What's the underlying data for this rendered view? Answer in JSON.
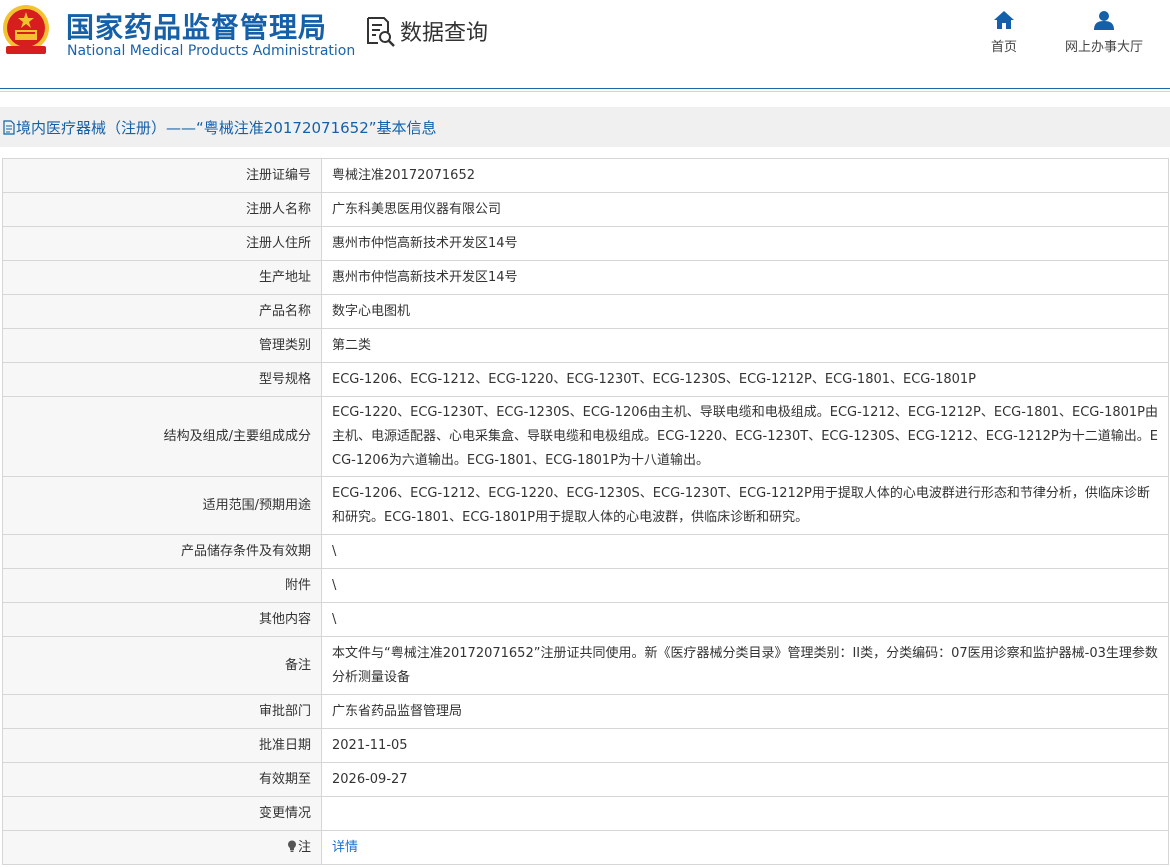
{
  "header": {
    "title_cn": "国家药品监督管理局",
    "title_en": "National Medical Products Administration",
    "query_label": "数据查询",
    "nav": {
      "home": "首页",
      "online_hall": "网上办事大厅"
    }
  },
  "page": {
    "heading": "境内医疗器械（注册）——“粤械注准20172071652”基本信息"
  },
  "rows": [
    {
      "label": "注册证编号",
      "value": "粤械注准20172071652"
    },
    {
      "label": "注册人名称",
      "value": "广东科美思医用仪器有限公司"
    },
    {
      "label": "注册人住所",
      "value": "惠州市仲恺高新技术开发区14号"
    },
    {
      "label": "生产地址",
      "value": "惠州市仲恺高新技术开发区14号"
    },
    {
      "label": "产品名称",
      "value": "数字心电图机"
    },
    {
      "label": "管理类别",
      "value": "第二类"
    },
    {
      "label": "型号规格",
      "value": "ECG-1206、ECG-1212、ECG-1220、ECG-1230T、ECG-1230S、ECG-1212P、ECG-1801、ECG-1801P"
    },
    {
      "label": "结构及组成/主要组成成分",
      "value": "ECG-1220、ECG-1230T、ECG-1230S、ECG-1206由主机、导联电缆和电极组成。ECG-1212、ECG-1212P、ECG-1801、ECG-1801P由主机、电源适配器、心电采集盒、导联电缆和电极组成。ECG-1220、ECG-1230T、ECG-1230S、ECG-1212、ECG-1212P为十二道输出。ECG-1206为六道输出。ECG-1801、ECG-1801P为十八道输出。"
    },
    {
      "label": "适用范围/预期用途",
      "value": "ECG-1206、ECG-1212、ECG-1220、ECG-1230S、ECG-1230T、ECG-1212P用于提取人体的心电波群进行形态和节律分析，供临床诊断和研究。ECG-1801、ECG-1801P用于提取人体的心电波群，供临床诊断和研究。"
    },
    {
      "label": "产品储存条件及有效期",
      "value": "\\"
    },
    {
      "label": "附件",
      "value": "\\"
    },
    {
      "label": "其他内容",
      "value": "\\"
    },
    {
      "label": "备注",
      "value": "本文件与“粤械注准20172071652”注册证共同使用。新《医疗器械分类目录》管理类别：II类，分类编码：07医用诊察和监护器械-03生理参数分析测量设备"
    },
    {
      "label": "审批部门",
      "value": "广东省药品监督管理局"
    },
    {
      "label": "批准日期",
      "value": "2021-11-05"
    },
    {
      "label": "有效期至",
      "value": "2026-09-27"
    },
    {
      "label": "变更情况",
      "value": ""
    }
  ],
  "note_row": {
    "label": "注",
    "link": "详情"
  },
  "colors": {
    "brand_blue": "#1560a8",
    "link_blue": "#1a6fd1",
    "emblem_red": "#d61e1e",
    "emblem_gold": "#f3c230"
  },
  "icons": [
    "national-emblem-icon",
    "data-query-icon",
    "home-icon",
    "user-icon",
    "document-icon",
    "lightbulb-icon"
  ]
}
